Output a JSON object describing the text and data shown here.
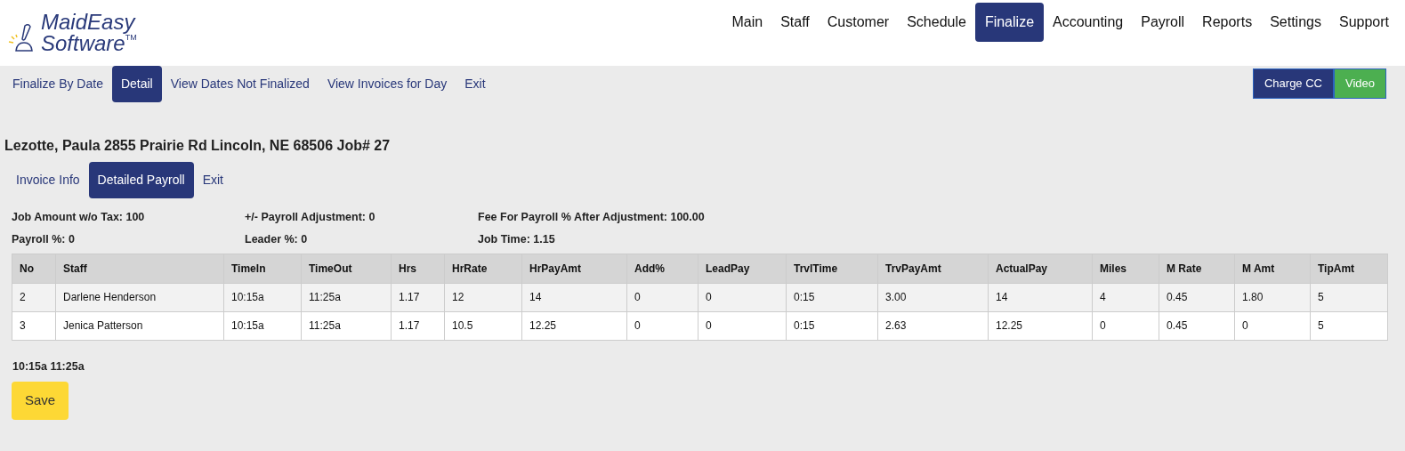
{
  "logo": {
    "line1": "MaidEasy",
    "line2": "Software",
    "mark": "TM"
  },
  "main_nav": [
    {
      "label": "Main",
      "selected": false
    },
    {
      "label": "Staff",
      "selected": false
    },
    {
      "label": "Customer",
      "selected": false
    },
    {
      "label": "Schedule",
      "selected": false
    },
    {
      "label": "Finalize",
      "selected": true
    },
    {
      "label": "Accounting",
      "selected": false
    },
    {
      "label": "Payroll",
      "selected": false
    },
    {
      "label": "Reports",
      "selected": false
    },
    {
      "label": "Settings",
      "selected": false
    },
    {
      "label": "Support",
      "selected": false
    }
  ],
  "sub_nav": [
    {
      "label": "Finalize By Date",
      "selected": false
    },
    {
      "label": "Detail",
      "selected": true
    },
    {
      "label": "View Dates Not Finalized",
      "selected": false
    },
    {
      "label": "View Invoices for Day",
      "selected": false
    },
    {
      "label": "Exit",
      "selected": false
    }
  ],
  "actions": [
    {
      "label": "Charge CC",
      "kind": "primary"
    },
    {
      "label": "Video",
      "kind": "success"
    }
  ],
  "job_title": "Lezotte, Paula 2855 Prairie Rd Lincoln, NE 68506 Job# 27",
  "detail_tabs": [
    {
      "label": "Invoice Info",
      "selected": false
    },
    {
      "label": "Detailed Payroll",
      "selected": true
    },
    {
      "label": "Exit",
      "selected": false
    }
  ],
  "summary": [
    [
      "Job Amount w/o Tax: 100",
      "Payroll %: 0"
    ],
    [
      "+/- Payroll Adjustment: 0",
      "Leader %: 0"
    ],
    [
      "Fee For Payroll % After Adjustment: 100.00",
      "Job Time: 1.15"
    ]
  ],
  "table": {
    "columns": [
      "No",
      "Staff",
      "TimeIn",
      "TimeOut",
      "Hrs",
      "HrRate",
      "HrPayAmt",
      "Add%",
      "LeadPay",
      "TrvlTime",
      "TrvPayAmt",
      "ActualPay",
      "Miles",
      "M Rate",
      "M Amt",
      "TipAmt"
    ],
    "rows": [
      [
        "2",
        "Darlene Henderson",
        "10:15a",
        "11:25a",
        "1.17",
        "12",
        "14",
        "0",
        "0",
        "0:15",
        "3.00",
        "14",
        "4",
        "0.45",
        "1.80",
        "5"
      ],
      [
        "3",
        "Jenica Patterson",
        "10:15a",
        "11:25a",
        "1.17",
        "10.5",
        "12.25",
        "0",
        "0",
        "0:15",
        "2.63",
        "12.25",
        "0",
        "0.45",
        "0",
        "5"
      ]
    ]
  },
  "times": "10:15a 11:25a",
  "save_button": "Save"
}
